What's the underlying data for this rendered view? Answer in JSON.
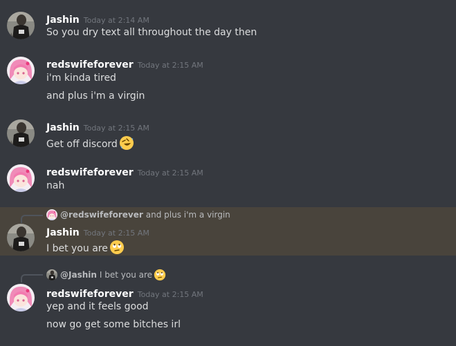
{
  "messages": [
    {
      "author": "Jashin",
      "avatar": "jashin-avatar",
      "timestamp": "Today at 2:14 AM",
      "lines": [
        "So you dry text all throughout the day then"
      ]
    },
    {
      "author": "redswifeforever",
      "avatar": "redswifeforever-avatar",
      "timestamp": "Today at 2:15 AM",
      "lines": [
        "i'm kinda tired",
        "and plus i'm a virgin"
      ]
    },
    {
      "author": "Jashin",
      "avatar": "jashin-avatar",
      "timestamp": "Today at 2:15 AM",
      "lines": [
        "Get off discord"
      ],
      "emoji": "rolling-on-floor-laughing-emoji"
    },
    {
      "author": "redswifeforever",
      "avatar": "redswifeforever-avatar",
      "timestamp": "Today at 2:15 AM",
      "lines": [
        "nah"
      ]
    },
    {
      "reply": {
        "mention": "@redswifeforever",
        "text": "and plus i'm a virgin",
        "avatar": "redswifeforever-avatar"
      },
      "author": "Jashin",
      "avatar": "jashin-avatar",
      "timestamp": "Today at 2:15 AM",
      "lines": [
        "I bet you are"
      ],
      "emoji": "face-with-rolling-eyes-emoji",
      "highlighted": true
    },
    {
      "reply": {
        "mention": "@Jashin",
        "text": "I bet you are",
        "avatar": "jashin-avatar",
        "emoji": "face-with-rolling-eyes-emoji"
      },
      "author": "redswifeforever",
      "avatar": "redswifeforever-avatar",
      "timestamp": "Today at 2:15 AM",
      "lines": [
        "yep and it feels good",
        "now go get some bitches irl"
      ]
    }
  ],
  "colors": {
    "background": "#36393f",
    "highlight": "#49443c",
    "username": "#ffffff",
    "text": "#dcddde",
    "timestamp": "#72767d"
  }
}
